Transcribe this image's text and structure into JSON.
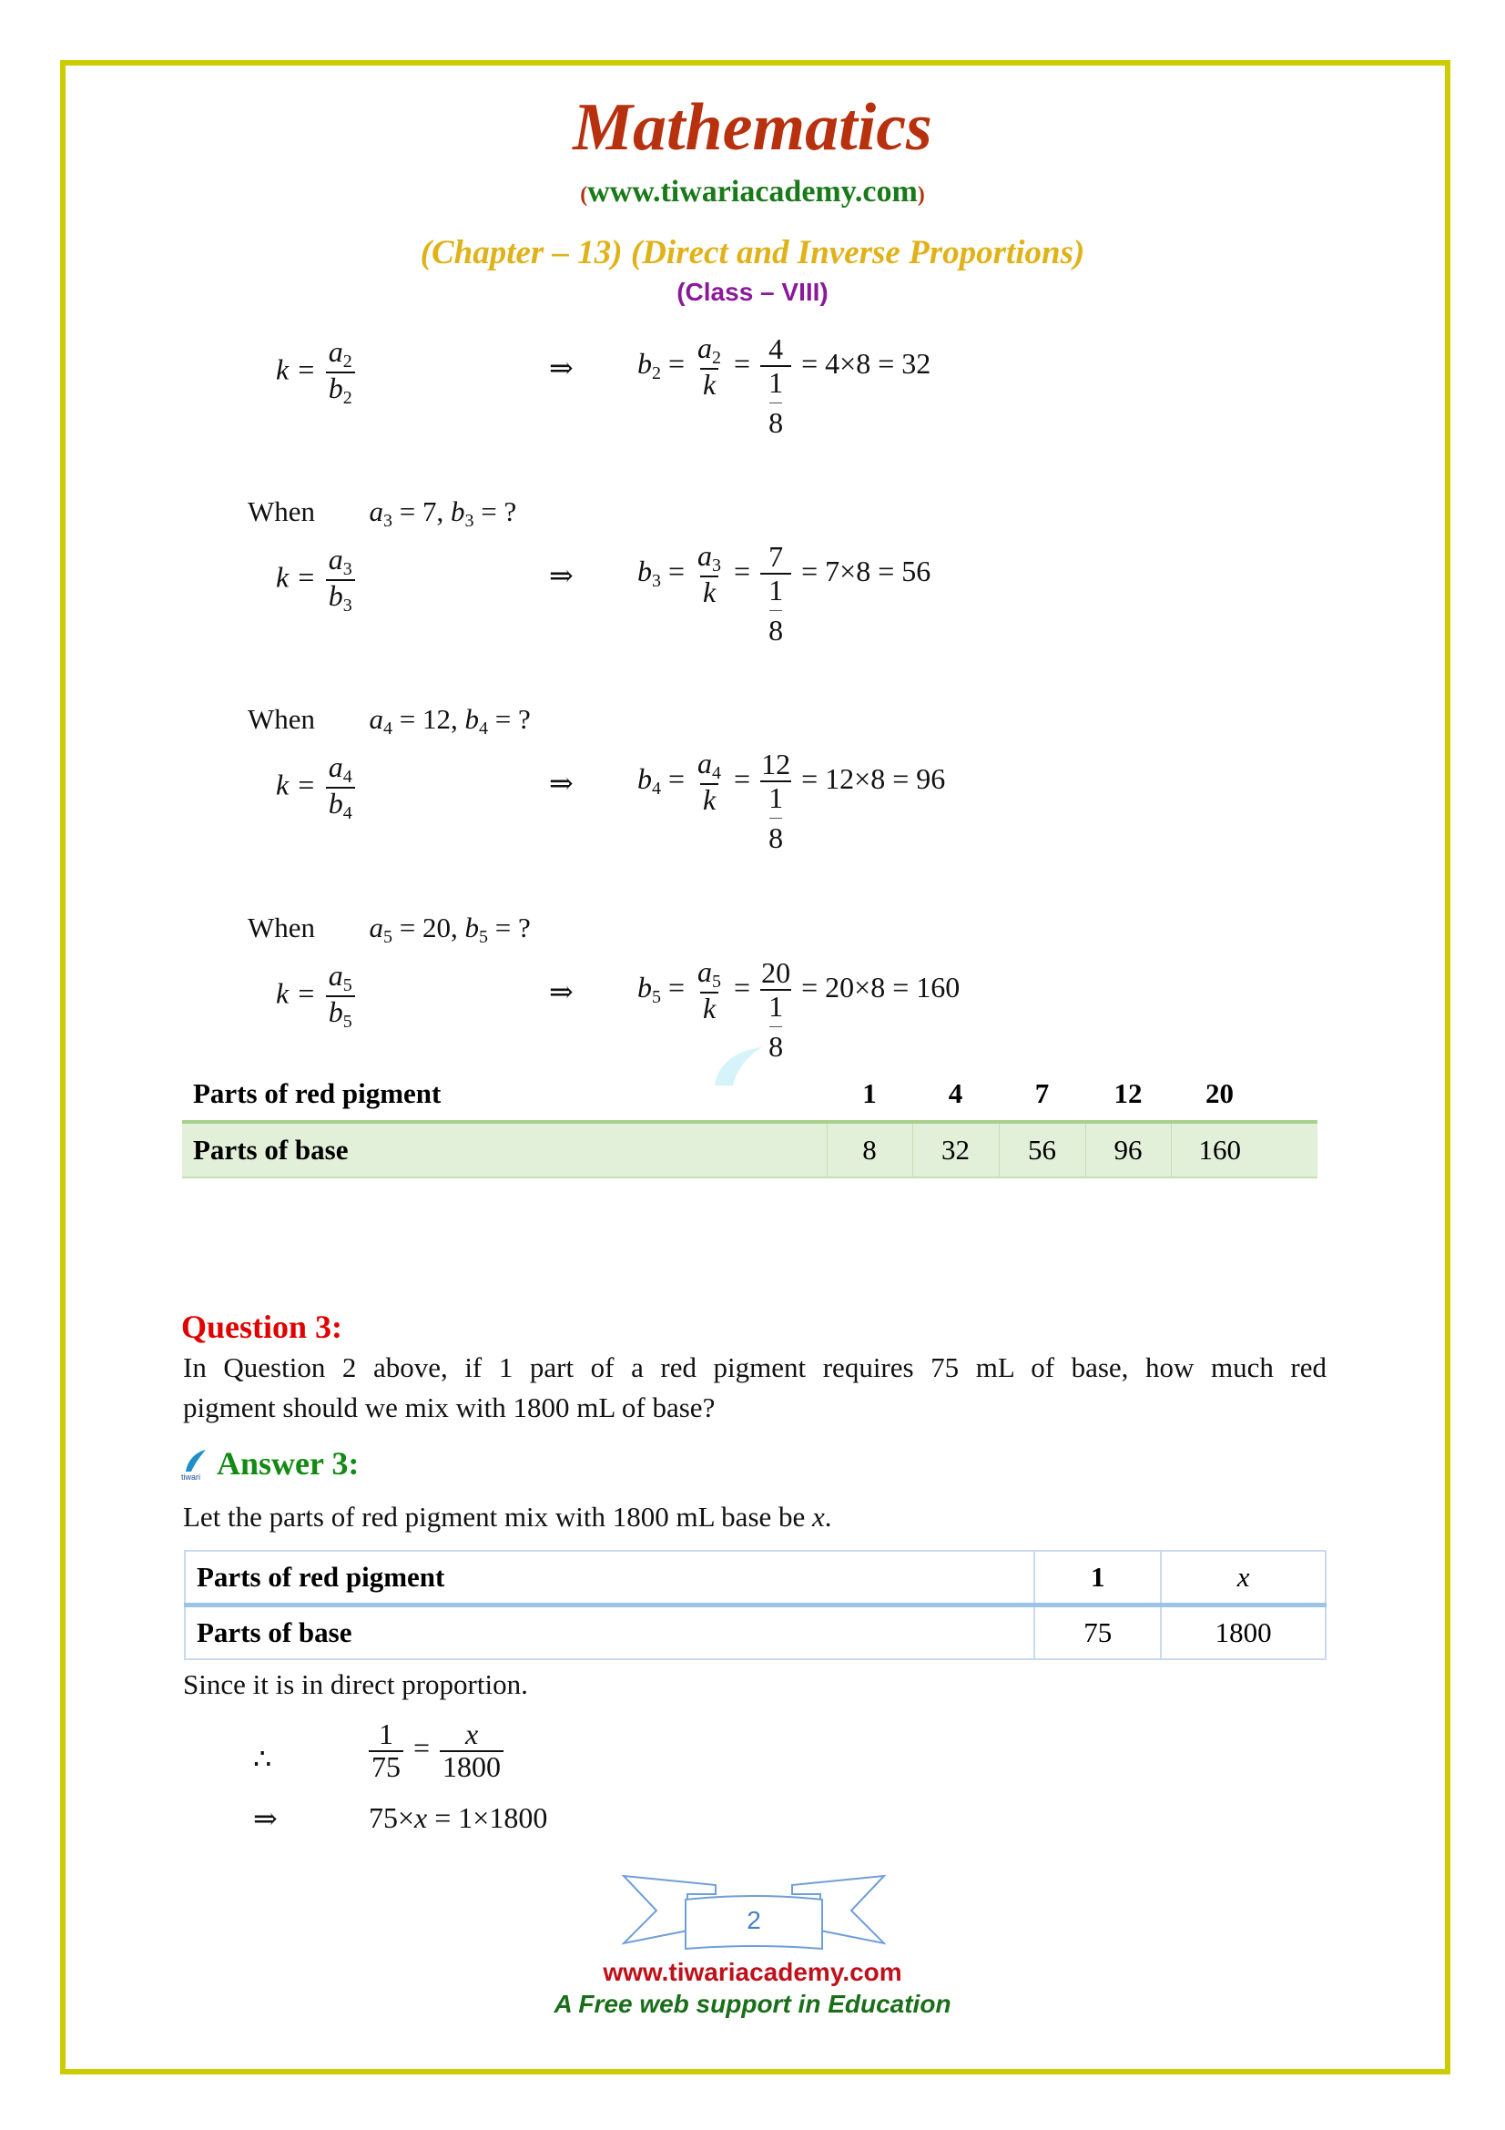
{
  "header": {
    "title": "Mathematics",
    "site_open": "(",
    "site": "www.tiwariacademy.com",
    "site_close": ")",
    "chapter": "(Chapter – 13) (Direct and Inverse Proportions)",
    "class": "(Class – VIII)"
  },
  "steps": [
    {
      "when_label": "",
      "condition": "",
      "k_num": "a",
      "k_num_sub": "2",
      "k_den": "b",
      "k_den_sub": "2",
      "implies": "⇒",
      "b_var": "b",
      "b_sub": "2",
      "a_var": "a",
      "a_sub": "2",
      "k": "k",
      "value": "4",
      "inner_num": "1",
      "inner_den": "8",
      "result": "= 4×8 = 32"
    },
    {
      "when_label": "When",
      "condition_a": "a",
      "condition_a_sub": "3",
      "condition_mid": " = 7, ",
      "condition_b": "b",
      "condition_b_sub": "3",
      "condition_end": " = ?",
      "k_num": "a",
      "k_num_sub": "3",
      "k_den": "b",
      "k_den_sub": "3",
      "implies": "⇒",
      "b_var": "b",
      "b_sub": "3",
      "a_var": "a",
      "a_sub": "3",
      "k": "k",
      "value": "7",
      "inner_num": "1",
      "inner_den": "8",
      "result": "= 7×8 = 56"
    },
    {
      "when_label": "When",
      "condition_a": "a",
      "condition_a_sub": "4",
      "condition_mid": " = 12, ",
      "condition_b": "b",
      "condition_b_sub": "4",
      "condition_end": " = ?",
      "k_num": "a",
      "k_num_sub": "4",
      "k_den": "b",
      "k_den_sub": "4",
      "implies": "⇒",
      "b_var": "b",
      "b_sub": "4",
      "a_var": "a",
      "a_sub": "4",
      "k": "k",
      "value": "12",
      "inner_num": "1",
      "inner_den": "8",
      "result": "= 12×8 = 96"
    },
    {
      "when_label": "When",
      "condition_a": "a",
      "condition_a_sub": "5",
      "condition_mid": " = 20, ",
      "condition_b": "b",
      "condition_b_sub": "5",
      "condition_end": " = ?",
      "k_num": "a",
      "k_num_sub": "5",
      "k_den": "b",
      "k_den_sub": "5",
      "implies": "⇒",
      "b_var": "b",
      "b_sub": "5",
      "a_var": "a",
      "a_sub": "5",
      "k": "k",
      "value": "20",
      "inner_num": "1",
      "inner_den": "8",
      "result": "= 20×8 = 160"
    }
  ],
  "k_prefix": "k =",
  "table1": {
    "rows": [
      {
        "label": "Parts of red pigment",
        "values": [
          "1",
          "4",
          "7",
          "12",
          "20"
        ]
      },
      {
        "label": "Parts of base",
        "values": [
          "8",
          "32",
          "56",
          "96",
          "160"
        ]
      }
    ],
    "accent_color": "#a8d08d"
  },
  "question3": {
    "heading": "Question 3:",
    "text_line1": "In Question 2 above, if 1 part of a red pigment requires 75 mL of base, how much red",
    "text_line2": "pigment should we mix with 1800 mL of base?"
  },
  "answer3": {
    "logo_icon": "tiwari-feather-logo",
    "heading": "Answer 3:",
    "intro": "Let the parts of red pigment mix with 1800 mL base be ",
    "intro_var": "x",
    "intro_end": ".",
    "table": {
      "rows": [
        {
          "label": "Parts of red pigment",
          "values": [
            "1",
            "x"
          ]
        },
        {
          "label": "Parts of base",
          "values": [
            "75",
            "1800"
          ]
        }
      ]
    },
    "since": "Since it is in direct proportion.",
    "therefore": "∴",
    "eq1_left_num": "1",
    "eq1_left_den": "75",
    "eq1_eq": "=",
    "eq1_right_num": "x",
    "eq1_right_den": "1800",
    "implies": "⇒",
    "eq2": "75×",
    "eq2_var": "x",
    "eq2_rest": " = 1×1800"
  },
  "footer": {
    "page_number": "2",
    "url": "www.tiwariacademy.com",
    "tagline": "A Free web support in Education"
  },
  "colors": {
    "border": "#cccc00",
    "title": "#b8310f",
    "site": "#1a7a1a",
    "chapter": "#e0b21a",
    "class": "#8b1a9b",
    "question": "#e00000",
    "answer": "#138a13"
  }
}
